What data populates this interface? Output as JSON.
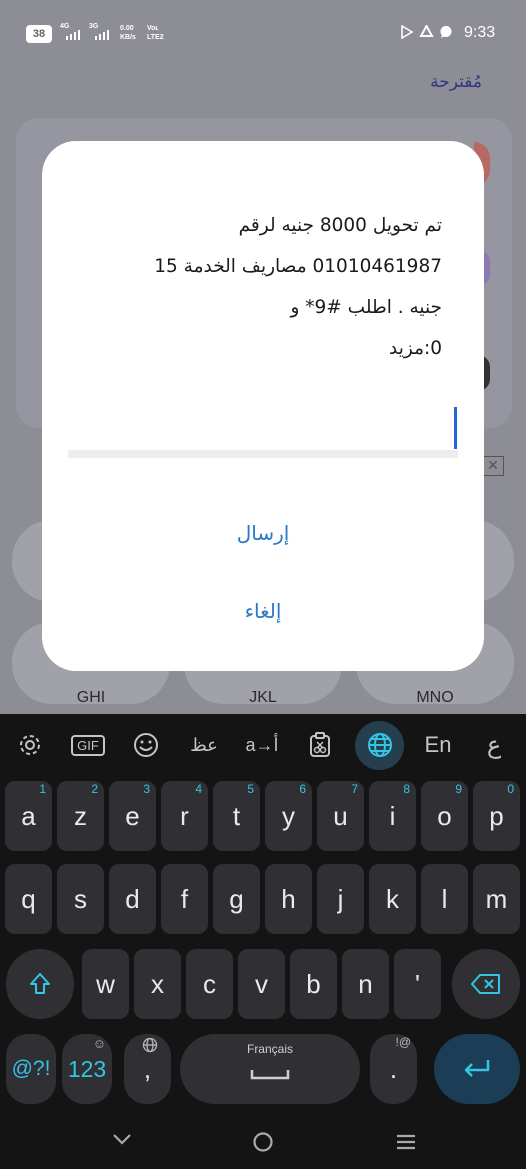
{
  "status_bar": {
    "battery": "38",
    "sim1": "4G",
    "sim2": "3G",
    "net_speed_value": "0.00",
    "net_speed_unit": "KB/s",
    "volte_top": "Voʟ",
    "volte_bottom": "LTE2",
    "time": "9:33"
  },
  "background_app": {
    "suggested_label": "مُقترحة",
    "dialpad_labels": [
      "GHI",
      "JKL",
      "MNO"
    ]
  },
  "dialog": {
    "message_lines": [
      "تم تحويل 8000 جنيه لرقم",
      "01010461987 مصاريف الخدمة 15",
      "جنيه . اطلب #9* و",
      "0:مزيد"
    ],
    "send_label": "إرسال",
    "cancel_label": "إلغاء"
  },
  "keyboard": {
    "toolbar": {
      "gif_label": "GIF",
      "arabic_glyph": "عظ",
      "translate_label": "a→أ",
      "lang_label": "En",
      "arabic_key_label": "ع"
    },
    "row1": [
      {
        "k": "a",
        "n": "1"
      },
      {
        "k": "z",
        "n": "2"
      },
      {
        "k": "e",
        "n": "3"
      },
      {
        "k": "r",
        "n": "4"
      },
      {
        "k": "t",
        "n": "5"
      },
      {
        "k": "y",
        "n": "6"
      },
      {
        "k": "u",
        "n": "7"
      },
      {
        "k": "i",
        "n": "8"
      },
      {
        "k": "o",
        "n": "9"
      },
      {
        "k": "p",
        "n": "0"
      }
    ],
    "row2": [
      "q",
      "s",
      "d",
      "f",
      "g",
      "h",
      "j",
      "k",
      "l",
      "m"
    ],
    "row3": [
      "w",
      "x",
      "c",
      "v",
      "b",
      "n",
      "'"
    ],
    "symbols_label": "@?!",
    "numbers_label": "123",
    "comma_label": ",",
    "space_label": "Français",
    "period_label": ".",
    "period_hint": "!@"
  },
  "colors": {
    "accent": "#33c5e3",
    "dialog_button": "#2a78c3",
    "cursor": "#2266d6",
    "scrim": "#8d8d96"
  }
}
